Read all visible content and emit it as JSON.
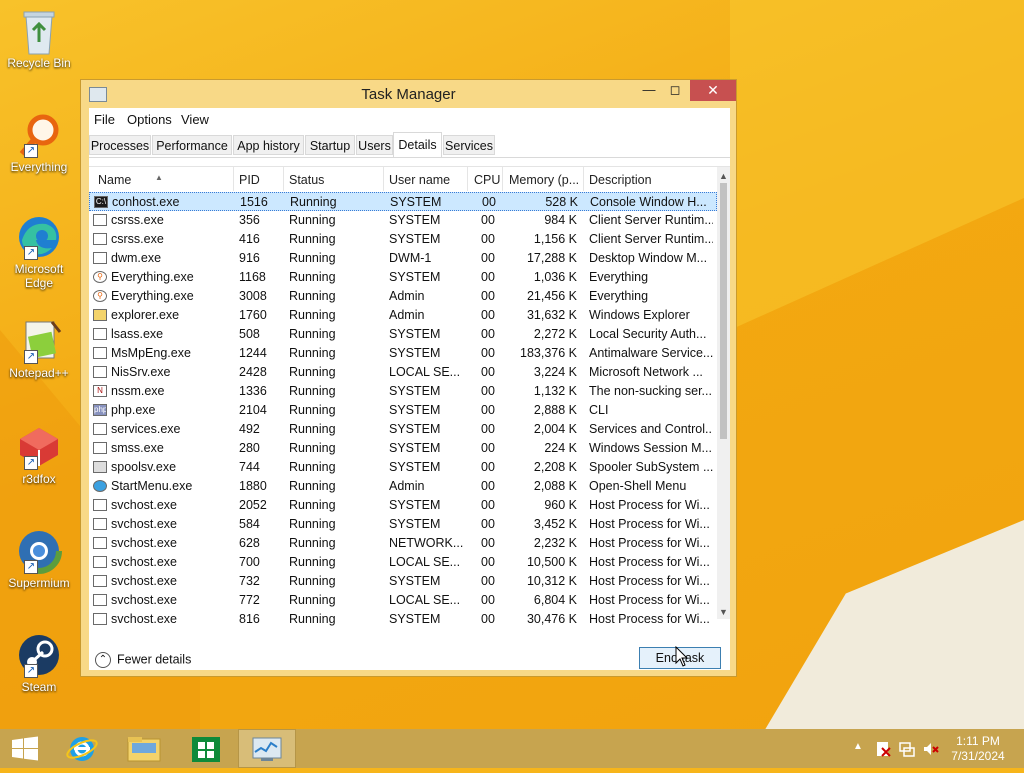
{
  "desktop": {
    "icons": [
      {
        "label": "Recycle Bin",
        "icon": "recycle-bin-icon"
      },
      {
        "label": "Everything",
        "icon": "magnifier-icon"
      },
      {
        "label": "Microsoft Edge",
        "icon": "edge-icon"
      },
      {
        "label": "Notepad++",
        "icon": "notepad-plus-icon"
      },
      {
        "label": "r3dfox",
        "icon": "fox-cube-icon"
      },
      {
        "label": "Supermium",
        "icon": "chromium-icon"
      },
      {
        "label": "Steam",
        "icon": "steam-icon"
      }
    ]
  },
  "window": {
    "title": "Task Manager",
    "menu": [
      "File",
      "Options",
      "View"
    ],
    "tabs": [
      "Processes",
      "Performance",
      "App history",
      "Startup",
      "Users",
      "Details",
      "Services"
    ],
    "active_tab": "Details",
    "columns": [
      "Name",
      "PID",
      "Status",
      "User name",
      "CPU",
      "Memory (p...",
      "Description"
    ],
    "rows": [
      {
        "name": "conhost.exe",
        "pid": "1516",
        "status": "Running",
        "user": "SYSTEM",
        "cpu": "00",
        "mem": "528 K",
        "desc": "Console Window H...",
        "icon": "console-icon",
        "selected": true
      },
      {
        "name": "csrss.exe",
        "pid": "356",
        "status": "Running",
        "user": "SYSTEM",
        "cpu": "00",
        "mem": "984 K",
        "desc": "Client Server Runtim...",
        "icon": "window-icon"
      },
      {
        "name": "csrss.exe",
        "pid": "416",
        "status": "Running",
        "user": "SYSTEM",
        "cpu": "00",
        "mem": "1,156 K",
        "desc": "Client Server Runtim...",
        "icon": "window-icon"
      },
      {
        "name": "dwm.exe",
        "pid": "916",
        "status": "Running",
        "user": "DWM-1",
        "cpu": "00",
        "mem": "17,288 K",
        "desc": "Desktop Window M...",
        "icon": "window-icon"
      },
      {
        "name": "Everything.exe",
        "pid": "1168",
        "status": "Running",
        "user": "SYSTEM",
        "cpu": "00",
        "mem": "1,036 K",
        "desc": "Everything",
        "icon": "magnifier-icon"
      },
      {
        "name": "Everything.exe",
        "pid": "3008",
        "status": "Running",
        "user": "Admin",
        "cpu": "00",
        "mem": "21,456 K",
        "desc": "Everything",
        "icon": "magnifier-icon"
      },
      {
        "name": "explorer.exe",
        "pid": "1760",
        "status": "Running",
        "user": "Admin",
        "cpu": "00",
        "mem": "31,632 K",
        "desc": "Windows Explorer",
        "icon": "folder-icon"
      },
      {
        "name": "lsass.exe",
        "pid": "508",
        "status": "Running",
        "user": "SYSTEM",
        "cpu": "00",
        "mem": "2,272 K",
        "desc": "Local Security Auth...",
        "icon": "window-icon"
      },
      {
        "name": "MsMpEng.exe",
        "pid": "1244",
        "status": "Running",
        "user": "SYSTEM",
        "cpu": "00",
        "mem": "183,376 K",
        "desc": "Antimalware Service...",
        "icon": "window-icon"
      },
      {
        "name": "NisSrv.exe",
        "pid": "2428",
        "status": "Running",
        "user": "LOCAL SE...",
        "cpu": "00",
        "mem": "3,224 K",
        "desc": "Microsoft Network ...",
        "icon": "window-icon"
      },
      {
        "name": "nssm.exe",
        "pid": "1336",
        "status": "Running",
        "user": "SYSTEM",
        "cpu": "00",
        "mem": "1,132 K",
        "desc": "The non-sucking ser...",
        "icon": "nssm-icon"
      },
      {
        "name": "php.exe",
        "pid": "2104",
        "status": "Running",
        "user": "SYSTEM",
        "cpu": "00",
        "mem": "2,888 K",
        "desc": "CLI",
        "icon": "php-icon"
      },
      {
        "name": "services.exe",
        "pid": "492",
        "status": "Running",
        "user": "SYSTEM",
        "cpu": "00",
        "mem": "2,004 K",
        "desc": "Services and Control...",
        "icon": "window-icon"
      },
      {
        "name": "smss.exe",
        "pid": "280",
        "status": "Running",
        "user": "SYSTEM",
        "cpu": "00",
        "mem": "224 K",
        "desc": "Windows Session M...",
        "icon": "window-icon"
      },
      {
        "name": "spoolsv.exe",
        "pid": "744",
        "status": "Running",
        "user": "SYSTEM",
        "cpu": "00",
        "mem": "2,208 K",
        "desc": "Spooler SubSystem ...",
        "icon": "printer-icon"
      },
      {
        "name": "StartMenu.exe",
        "pid": "1880",
        "status": "Running",
        "user": "Admin",
        "cpu": "00",
        "mem": "2,088 K",
        "desc": "Open-Shell Menu",
        "icon": "shell-icon"
      },
      {
        "name": "svchost.exe",
        "pid": "2052",
        "status": "Running",
        "user": "SYSTEM",
        "cpu": "00",
        "mem": "960 K",
        "desc": "Host Process for Wi...",
        "icon": "window-icon"
      },
      {
        "name": "svchost.exe",
        "pid": "584",
        "status": "Running",
        "user": "SYSTEM",
        "cpu": "00",
        "mem": "3,452 K",
        "desc": "Host Process for Wi...",
        "icon": "window-icon"
      },
      {
        "name": "svchost.exe",
        "pid": "628",
        "status": "Running",
        "user": "NETWORK...",
        "cpu": "00",
        "mem": "2,232 K",
        "desc": "Host Process for Wi...",
        "icon": "window-icon"
      },
      {
        "name": "svchost.exe",
        "pid": "700",
        "status": "Running",
        "user": "LOCAL SE...",
        "cpu": "00",
        "mem": "10,500 K",
        "desc": "Host Process for Wi...",
        "icon": "window-icon"
      },
      {
        "name": "svchost.exe",
        "pid": "732",
        "status": "Running",
        "user": "SYSTEM",
        "cpu": "00",
        "mem": "10,312 K",
        "desc": "Host Process for Wi...",
        "icon": "window-icon"
      },
      {
        "name": "svchost.exe",
        "pid": "772",
        "status": "Running",
        "user": "LOCAL SE...",
        "cpu": "00",
        "mem": "6,804 K",
        "desc": "Host Process for Wi...",
        "icon": "window-icon"
      },
      {
        "name": "svchost.exe",
        "pid": "816",
        "status": "Running",
        "user": "SYSTEM",
        "cpu": "00",
        "mem": "30,476 K",
        "desc": "Host Process for Wi...",
        "icon": "window-icon"
      }
    ],
    "fewer_details": "Fewer details",
    "end_task": "End task"
  },
  "taskbar": {
    "pinned": [
      "windows-start-icon",
      "internet-explorer-icon",
      "file-explorer-icon",
      "store-icon",
      "task-manager-icon"
    ],
    "clock_time": "1:11 PM",
    "clock_date": "7/31/2024"
  },
  "colors": {
    "selection": "#cce8ff",
    "close_button": "#c75050",
    "window_frame": "#f8d987",
    "taskbar": "#c7a44f"
  }
}
